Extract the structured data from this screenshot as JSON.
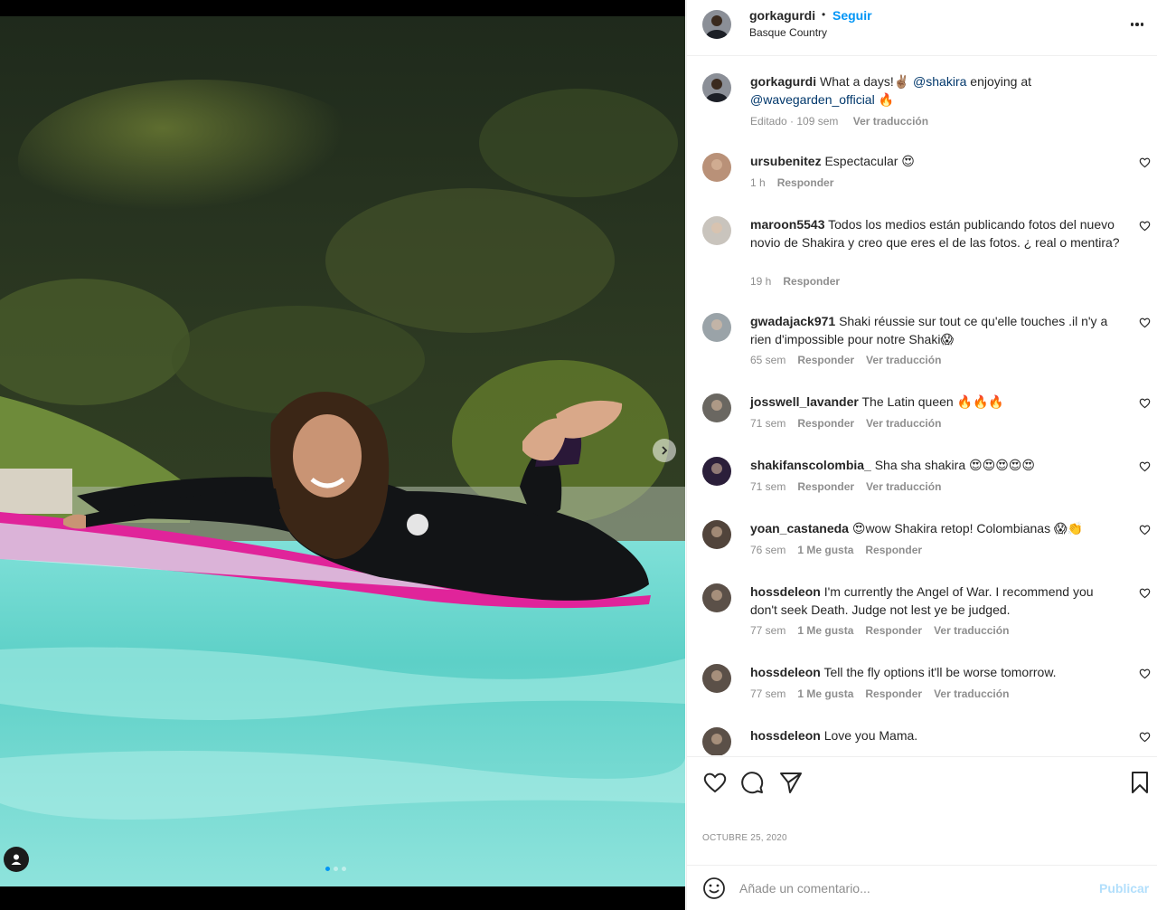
{
  "post": {
    "username": "gorkagurdi",
    "separator": "•",
    "follow_label": "Seguir",
    "location": "Basque Country",
    "more_icon": "more-horizontal-icon"
  },
  "caption": {
    "username": "gorkagurdi",
    "text_before": "What a days!✌🏽",
    "mention1": "@shakira",
    "text_mid": "enjoying at",
    "mention2": "@wavegarden_official",
    "text_after": "🔥",
    "edited": "Editado · 109 sem",
    "translate": "Ver traducción"
  },
  "comments": [
    {
      "username": "ursubenitez",
      "text": "Espectacular 😍",
      "time": "1 h",
      "likes": "",
      "reply": "Responder",
      "translate": ""
    },
    {
      "username": "maroon5543",
      "text": "Todos los medios están publicando fotos del nuevo novio de Shakira y creo que eres el de las fotos. ¿ real o mentira?",
      "time": "19 h",
      "likes": "",
      "reply": "Responder",
      "translate": ""
    },
    {
      "username": "gwadajack971",
      "text": "Shaki réussie sur tout ce qu'elle touches .il n'y a rien d'impossible pour notre Shaki😱",
      "time": "65 sem",
      "likes": "",
      "reply": "Responder",
      "translate": "Ver traducción"
    },
    {
      "username": "josswell_lavander",
      "text": "The Latin queen 🔥🔥🔥",
      "time": "71 sem",
      "likes": "",
      "reply": "Responder",
      "translate": "Ver traducción"
    },
    {
      "username": "shakifanscolombia_",
      "text": "Sha sha shakira 😍😍😍😍😍",
      "time": "71 sem",
      "likes": "",
      "reply": "Responder",
      "translate": "Ver traducción"
    },
    {
      "username": "yoan_castaneda",
      "text": "😍wow Shakira retop! Colombianas 😱👏",
      "time": "76 sem",
      "likes": "1 Me gusta",
      "reply": "Responder",
      "translate": ""
    },
    {
      "username": "hossdeleon",
      "text": "I'm currently the Angel of War. I recommend you don't seek Death. Judge not lest ye be judged.",
      "time": "77 sem",
      "likes": "1 Me gusta",
      "reply": "Responder",
      "translate": "Ver traducción"
    },
    {
      "username": "hossdeleon",
      "text": "Tell the fly options it'll be worse tomorrow.",
      "time": "77 sem",
      "likes": "1 Me gusta",
      "reply": "Responder",
      "translate": "Ver traducción"
    },
    {
      "username": "hossdeleon",
      "text": "Love you Mama.",
      "time": "",
      "likes": "",
      "reply": "",
      "translate": ""
    }
  ],
  "actions": {
    "like_icon": "heart-icon",
    "comment_icon": "comment-icon",
    "share_icon": "send-icon",
    "save_icon": "bookmark-icon"
  },
  "date": "OCTUBRE 25, 2020",
  "add_comment": {
    "placeholder": "Añade un comentario...",
    "post_label": "Publicar",
    "emoji_icon": "emoji-icon"
  },
  "carousel": {
    "slides": 3,
    "active_slide": 1
  },
  "colors": {
    "link_blue": "#0095f6",
    "mention_blue": "#00376b",
    "muted_text": "#8e8e8e",
    "post_button_disabled": "#b2dffc"
  }
}
